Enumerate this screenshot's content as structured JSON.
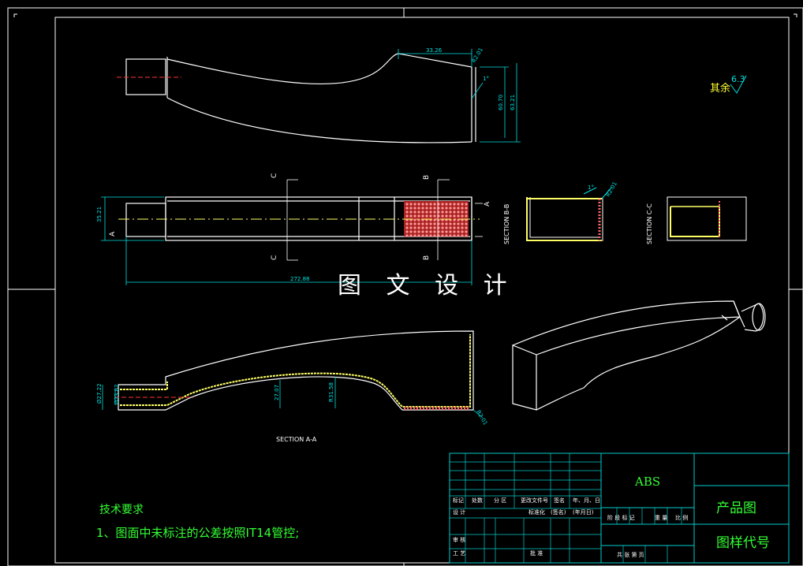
{
  "watermark": "图 文 设 计",
  "roughness": {
    "label": "其余",
    "value": "6.3"
  },
  "dimensions": {
    "top_width": "33.26",
    "top_wall": "R2.01",
    "top_h1": "60.70",
    "top_h2": "63.21",
    "top_angle": "1°",
    "mid_height": "35.21",
    "mid_length": "272.88",
    "bb_angle": "1°",
    "bb_wall": "R2.01",
    "aa_d1": "Ø27.22",
    "aa_d2": "Ø23.82",
    "aa_h1": "27.07",
    "aa_r": "R31.58",
    "aa_wall": "R2.01"
  },
  "section_marks": {
    "a": "A",
    "b": "B",
    "c": "C",
    "section_bb": "SECTION B-B",
    "section_cc": "SECTION C-C",
    "section_aa": "SECTION A-A"
  },
  "notes": {
    "title": "技术要求",
    "item1": "1、图面中未标注的公差按照IT14管控;"
  },
  "title_block": {
    "material": "ABS",
    "product": "产品图",
    "drawing_no": "图样代号",
    "labels": {
      "mark": "标记",
      "count": "处数",
      "zone": "分 区",
      "change_doc": "更改文件号",
      "sign": "签名",
      "date": "年、月、日",
      "design": "设 计",
      "standardize": "标准化",
      "sign2": "(签名)",
      "date2": "(年月日)",
      "review": "审 核",
      "process": "工 艺",
      "approve": "批 准",
      "stage": "阶 段 标 记",
      "weight": "重 量",
      "scale": "比 例",
      "sheets": "共 张 第 页"
    }
  },
  "colors": {
    "outline": "#ffffff",
    "dimension": "#00e0e0",
    "hatch": "#ffff66",
    "centerline": "#ff3333",
    "text_green": "#33ff33",
    "note_yellow": "#ffff33",
    "title_block": "#00cccc"
  }
}
